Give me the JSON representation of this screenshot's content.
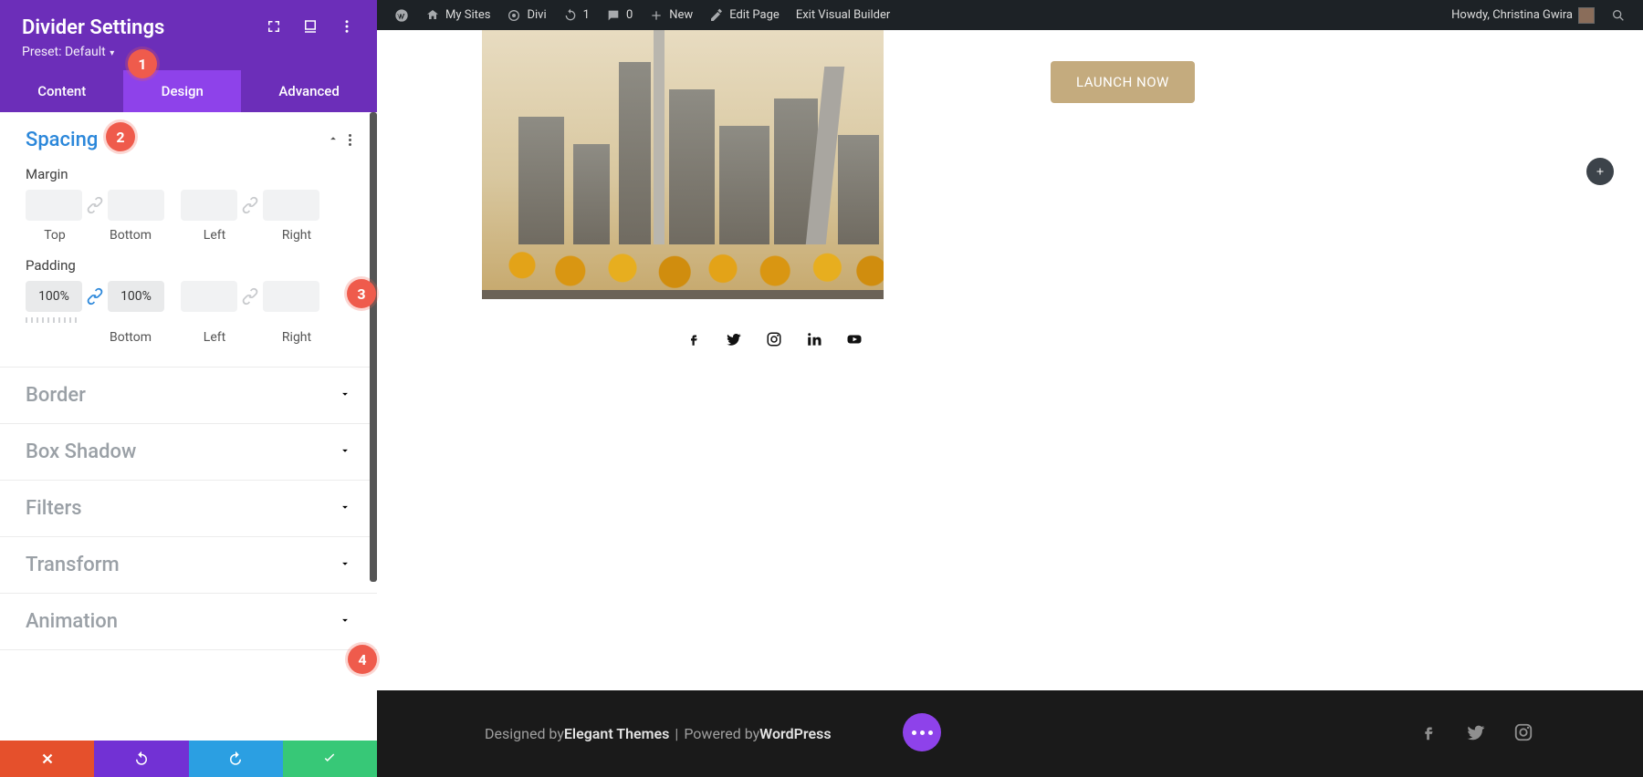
{
  "sidebar": {
    "title": "Divider Settings",
    "preset_label": "Preset: Default",
    "tabs": [
      "Content",
      "Design",
      "Advanced"
    ],
    "active_tab": 1,
    "spacing": {
      "title": "Spacing",
      "margin_label": "Margin",
      "padding_label": "Padding",
      "sub_labels": [
        "Top",
        "Bottom",
        "Left",
        "Right"
      ],
      "margin": {
        "top": "",
        "bottom": "",
        "left": "",
        "right": ""
      },
      "padding": {
        "top": "100%",
        "bottom": "100%",
        "left": "",
        "right": ""
      }
    },
    "sections": [
      "Border",
      "Box Shadow",
      "Filters",
      "Transform",
      "Animation"
    ]
  },
  "adminbar": {
    "my_sites": "My Sites",
    "site_name": "Divi",
    "updates": "1",
    "comments": "0",
    "new": "New",
    "edit_page": "Edit Page",
    "exit_vb": "Exit Visual Builder",
    "howdy": "Howdy, Christina Gwira"
  },
  "content": {
    "launch": "LAUNCH NOW"
  },
  "footer": {
    "designed_by": "Designed by ",
    "elegant": "Elegant Themes",
    "powered": " Powered by ",
    "wp": "WordPress"
  },
  "callouts": [
    "1",
    "2",
    "3",
    "4"
  ]
}
